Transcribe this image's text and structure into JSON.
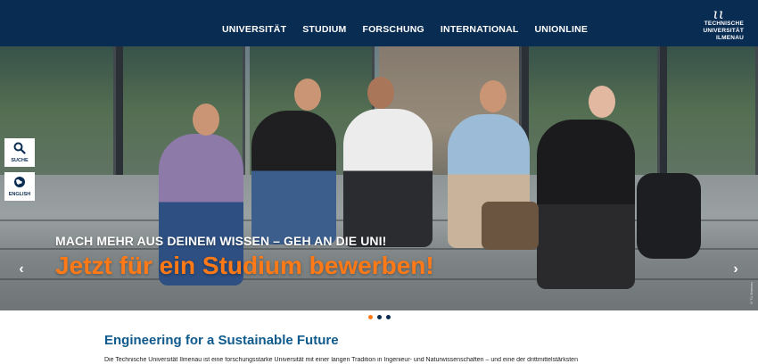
{
  "nav": {
    "items": [
      "UNIVERSITÄT",
      "STUDIUM",
      "FORSCHUNG",
      "INTERNATIONAL",
      "UNIONLINE"
    ]
  },
  "logo": {
    "mark": "ιι",
    "line1": "TECHNISCHE UNIVERSITÄT",
    "line2": "ILMENAU"
  },
  "side": {
    "search_label": "SUCHE",
    "search_icon": "search-icon",
    "lang_label": "ENGLISH",
    "lang_icon": "globe-icon"
  },
  "hero": {
    "kicker": "MACH MEHR AUS DEINEM WISSEN – GEH AN DIE UNI!",
    "headline": "Jetzt für ein Studium bewerben!",
    "prev_arrow": "‹",
    "next_arrow": "›",
    "photo_credit": "©TU Ilmenau",
    "slides": 3,
    "active_slide": 1
  },
  "colors": {
    "brand_blue": "#0a2c52",
    "accent_orange": "#ff7a17",
    "title_blue": "#0f5a8c",
    "dot_active": "#ff7a17",
    "dot_inactive": "#0a2c52"
  },
  "content": {
    "title": "Engineering for a Sustainable Future",
    "intro": "Die Technische Universität Ilmenau ist eine forschungsstarke Universität mit einer langen Tradition in Ingenieur- und Naturwissenschaften – und eine der drittmittelstärksten"
  }
}
